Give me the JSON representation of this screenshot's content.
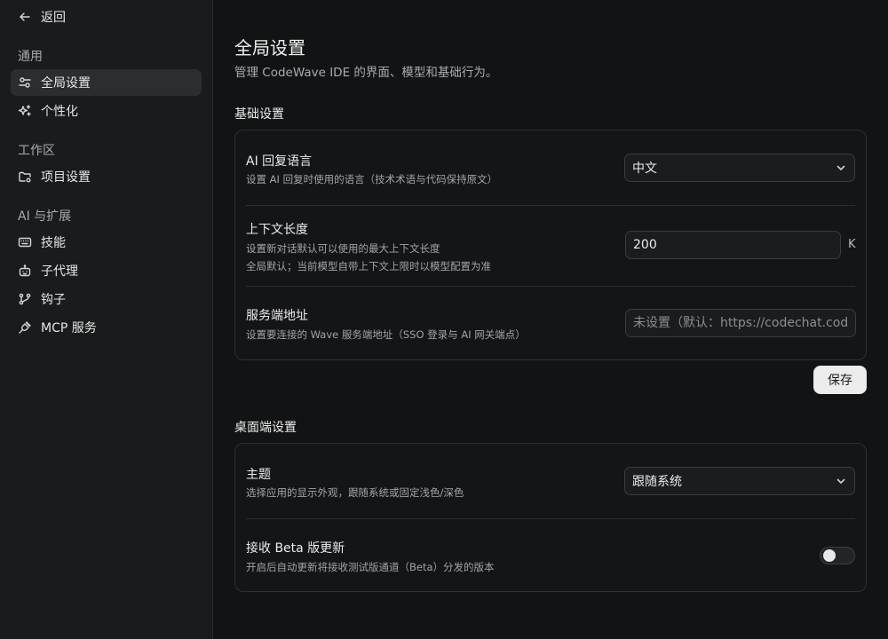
{
  "sidebar": {
    "back_label": "返回",
    "groups": [
      {
        "label": "通用",
        "items": [
          {
            "label": "全局设置",
            "icon": "sliders-icon",
            "active": true
          },
          {
            "label": "个性化",
            "icon": "sparkles-icon",
            "active": false
          }
        ]
      },
      {
        "label": "工作区",
        "items": [
          {
            "label": "项目设置",
            "icon": "folder-settings-icon",
            "active": false
          }
        ]
      },
      {
        "label": "AI 与扩展",
        "items": [
          {
            "label": "技能",
            "icon": "keyboard-icon",
            "active": false
          },
          {
            "label": "子代理",
            "icon": "robot-icon",
            "active": false
          },
          {
            "label": "钩子",
            "icon": "git-branch-icon",
            "active": false
          },
          {
            "label": "MCP 服务",
            "icon": "plug-icon",
            "active": false
          }
        ]
      }
    ]
  },
  "page": {
    "title": "全局设置",
    "subtitle": "管理 CodeWave IDE 的界面、模型和基础行为。"
  },
  "basic": {
    "section_title": "基础设置",
    "language": {
      "title": "AI 回复语言",
      "desc": "设置 AI 回复时使用的语言（技术术语与代码保持原文）",
      "value": "中文"
    },
    "context": {
      "title": "上下文长度",
      "desc1": "设置新对话默认可以使用的最大上下文长度",
      "desc2": "全局默认；当前模型自带上下文上限时以模型配置为准",
      "value": "200",
      "unit": "K"
    },
    "server": {
      "title": "服务端地址",
      "desc": "设置要连接的 Wave 服务端地址（SSO 登录与 AI 网关端点）",
      "placeholder": "未设置（默认：https://codechat.codew",
      "value": ""
    },
    "save_label": "保存"
  },
  "desktop": {
    "section_title": "桌面端设置",
    "theme": {
      "title": "主题",
      "desc": "选择应用的显示外观，跟随系统或固定浅色/深色",
      "value": "跟随系统"
    },
    "beta": {
      "title": "接收 Beta 版更新",
      "desc": "开启后自动更新将接收测试版通道（Beta）分发的版本",
      "enabled": false
    }
  },
  "colors": {
    "background": "#121314",
    "sidebar": "#1a1b1d",
    "active_item": "#2c2d30",
    "save_button": "#ececec"
  }
}
